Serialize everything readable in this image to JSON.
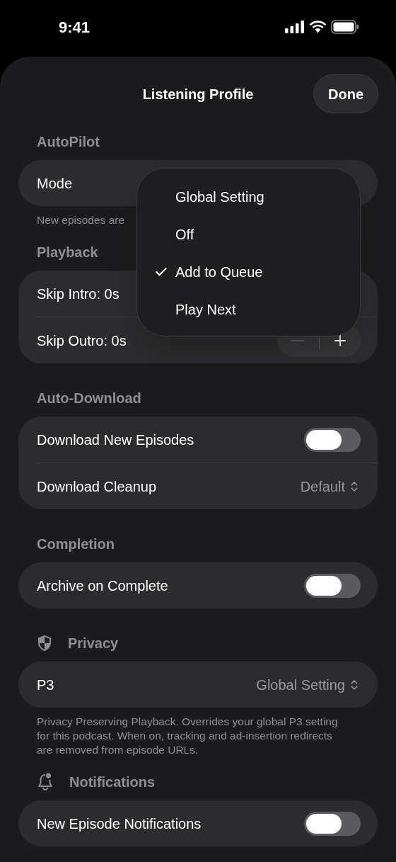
{
  "status_bar": {
    "time": "9:41"
  },
  "header": {
    "title": "Listening Profile",
    "done_button": "Done"
  },
  "sections": [
    {
      "kind": "plain",
      "title": "AutoPilot",
      "rows": [
        {
          "kind": "label",
          "label": "Mode"
        }
      ],
      "footer": "New episodes are"
    },
    {
      "kind": "plain",
      "title": "Playback",
      "rows": [
        {
          "kind": "label",
          "label": "Skip Intro: 0s"
        },
        {
          "kind": "stepper",
          "label": "Skip Outro: 0s",
          "decrement_disabled": true
        }
      ]
    },
    {
      "kind": "plain",
      "title": "Auto-Download",
      "rows": [
        {
          "kind": "toggle",
          "label": "Download New Episodes",
          "on": false
        },
        {
          "kind": "picker",
          "label": "Download Cleanup",
          "value": "Default"
        }
      ]
    },
    {
      "kind": "plain",
      "title": "Completion",
      "rows": [
        {
          "kind": "toggle",
          "label": "Archive on Complete",
          "on": false
        }
      ]
    },
    {
      "kind": "privacy",
      "title": "Privacy",
      "rows": [
        {
          "kind": "picker",
          "label": "P3",
          "value": "Global Setting"
        }
      ],
      "footer": "Privacy Preserving Playback. Overrides your global P3 setting for this podcast. When on, tracking and ad-insertion redirects are removed from episode URLs."
    },
    {
      "kind": "notifications",
      "title": "Notifications",
      "rows": [
        {
          "kind": "toggle",
          "label": "New Episode Notifications",
          "on": false
        }
      ]
    }
  ],
  "menu": {
    "items": [
      {
        "label": "Global Setting",
        "selected": false
      },
      {
        "label": "Off",
        "selected": false
      },
      {
        "label": "Add to Queue",
        "selected": true
      },
      {
        "label": "Play Next",
        "selected": false
      }
    ]
  }
}
